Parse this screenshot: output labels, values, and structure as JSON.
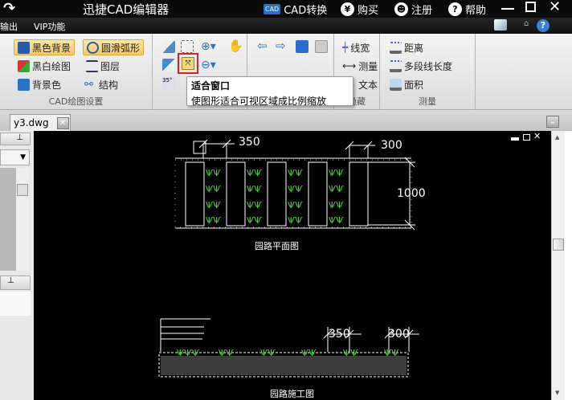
{
  "title": "迅捷CAD编辑器",
  "titlebar": {
    "cad_convert": "CAD转换",
    "buy": "购买",
    "register": "注册",
    "help": "帮助",
    "cad_icon": "CAD",
    "yen": "¥",
    "q": "?"
  },
  "menu": {
    "items": [
      "输出",
      "VIP功能"
    ]
  },
  "ribbon": {
    "settings": {
      "label": "CAD绘图设置",
      "black_bg": "黑色背景",
      "smooth_arc": "圆滑弧形",
      "bw_draw": "黑白绘图",
      "layers": "图层",
      "bg_color": "背景色",
      "structure": "结构"
    },
    "hide": {
      "label": "隐藏",
      "linewidth": "线宽",
      "measure": "测量",
      "text": "文本"
    },
    "measure": {
      "label": "测量",
      "distance": "距离",
      "polyline_length": "多段线长度",
      "area": "面积"
    }
  },
  "tooltip": {
    "title": "适合窗口",
    "desc": "使图形适合可视区域成比例缩放"
  },
  "tabs": [
    {
      "label": "y3.dwg"
    }
  ],
  "drawing": {
    "plan_title": "园路平面图",
    "plan_dim1": "350",
    "plan_dim2": "300",
    "plan_dim3": "1000",
    "section_title": "园路施工图",
    "section_dim1": "350",
    "section_dim2": "300"
  }
}
